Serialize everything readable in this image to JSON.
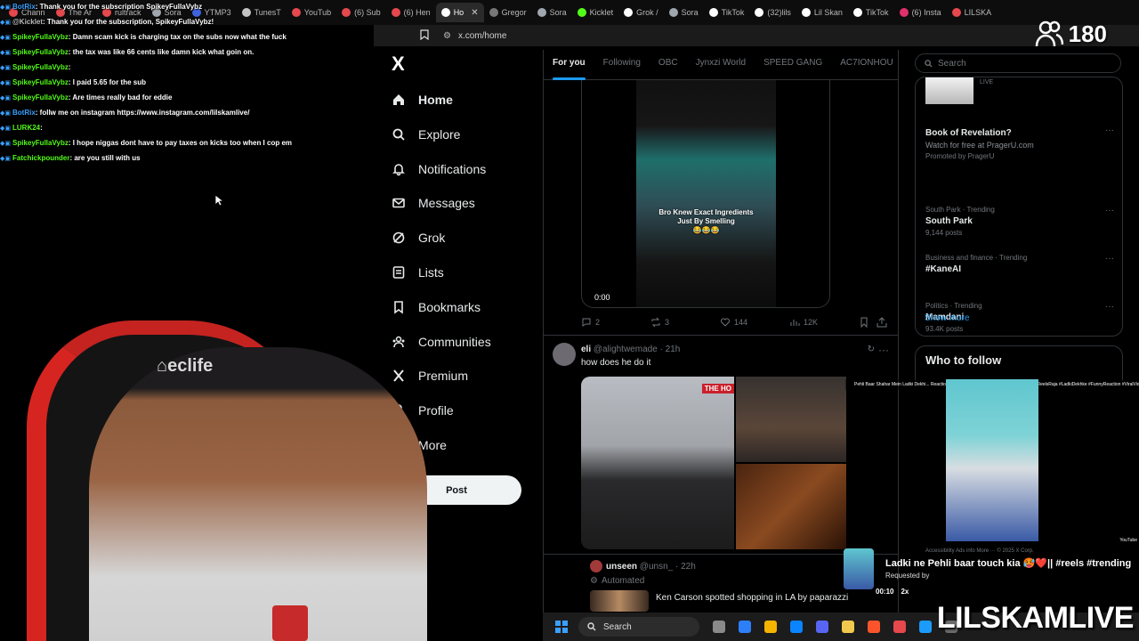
{
  "browser": {
    "tabs": [
      {
        "label": "Chann",
        "color": "#e5484d"
      },
      {
        "label": "The Ar",
        "color": "#e5484d"
      },
      {
        "label": "rultrack",
        "color": "#e5484d"
      },
      {
        "label": "Sora",
        "color": "#9fa6ad"
      },
      {
        "label": "YTMP3",
        "color": "#3e63dd"
      },
      {
        "label": "TunesT",
        "color": "#c4c4c4"
      },
      {
        "label": "YouTub",
        "color": "#e5484d"
      },
      {
        "label": "(6) Sub",
        "color": "#e5484d"
      },
      {
        "label": "(6) Hen",
        "color": "#e5484d"
      },
      {
        "label": "Ho",
        "color": "#ffffff",
        "active": true
      },
      {
        "label": "Gregor",
        "color": "#777777"
      },
      {
        "label": "Sora",
        "color": "#9fa6ad"
      },
      {
        "label": "Kicklet",
        "color": "#53fc18"
      },
      {
        "label": "Grok /",
        "color": "#ffffff"
      },
      {
        "label": "Sora",
        "color": "#9fa6ad"
      },
      {
        "label": "TikTok",
        "color": "#ffffff"
      },
      {
        "label": "(32)lils",
        "color": "#ffffff"
      },
      {
        "label": "Lil Skan",
        "color": "#ffffff"
      },
      {
        "label": "TikTok",
        "color": "#ffffff"
      },
      {
        "label": "(6) Insta",
        "color": "#e1306c"
      },
      {
        "label": "LILSKA",
        "color": "#e5484d"
      }
    ],
    "close_glyph": "✕",
    "url": "x.com/home"
  },
  "stream": {
    "viewer_count": "180",
    "brand": "LILSKAMLIVE",
    "chat": [
      {
        "user": "BotRix",
        "msg": ": Thank you for the subscription SpikeyFullaVybz",
        "color": "#3aa0ff"
      },
      {
        "user": "@Kicklet",
        "msg": ": Thank you for the subscription, SpikeyFullaVybz!",
        "color": "#bbbbbb"
      },
      {
        "user": "SpikeyFullaVybz",
        "msg": ": Damn scam kick is charging tax on the subs now what the fuck",
        "color": "#53fc18"
      },
      {
        "user": "SpikeyFullaVybz",
        "msg": ": the tax was like 66 cents like damn kick what goin on.",
        "color": "#53fc18"
      },
      {
        "user": "SpikeyFullaVybz",
        "msg": ":",
        "color": "#53fc18"
      },
      {
        "user": "SpikeyFullaVybz",
        "msg": ": I paid 5.65 for the sub",
        "color": "#53fc18"
      },
      {
        "user": "SpikeyFullaVybz",
        "msg": ": Are times really bad for eddie",
        "color": "#53fc18"
      },
      {
        "user": "BotRix",
        "msg": ": follw me on instagram https://www.instagram.com/lilskamlive/",
        "color": "#3aa0ff"
      },
      {
        "user": "LURK24",
        "msg": ":",
        "color": "#53fc18"
      },
      {
        "user": "SpikeyFullaVybz",
        "msg": ": I hope niggas dont have to pay taxes on kicks too when I cop em",
        "color": "#53fc18"
      },
      {
        "user": "Fatchickpounder",
        "msg": ": are you still with us",
        "color": "#53fc18"
      }
    ]
  },
  "nav": {
    "logo": "X",
    "items": [
      {
        "label": "Home",
        "icon": "home-icon"
      },
      {
        "label": "Explore",
        "icon": "search-icon"
      },
      {
        "label": "Notifications",
        "icon": "bell-icon"
      },
      {
        "label": "Messages",
        "icon": "mail-icon"
      },
      {
        "label": "Grok",
        "icon": "grok-icon"
      },
      {
        "label": "Lists",
        "icon": "list-icon"
      },
      {
        "label": "Bookmarks",
        "icon": "bookmark-icon"
      },
      {
        "label": "Communities",
        "icon": "people-icon"
      },
      {
        "label": "Premium",
        "icon": "x-icon"
      },
      {
        "label": "Profile",
        "icon": "person-icon"
      },
      {
        "label": "More",
        "icon": "more-circle-icon"
      }
    ],
    "post_label": "Post"
  },
  "feed": {
    "tabs": [
      "For you",
      "Following",
      "OBC",
      "Jynxzi World",
      "SPEED GANG",
      "AC7IONHOU"
    ],
    "active_tab": "For you",
    "tweet1": {
      "video_caption_1": "Bro Knew Exact Ingredients",
      "video_caption_2": "Just By Smelling",
      "video_emoji": "😂😂😂",
      "video_time": "0:00",
      "replies": "2",
      "reposts": "3",
      "likes": "144",
      "views": "12K"
    },
    "tweet2": {
      "name": "eli",
      "handle": "@alightwemade · 21h",
      "text": "how does he do it",
      "media_tag": "THE HO"
    },
    "tweet3": {
      "name": "unseen",
      "handle": "@unsn_ · 22h",
      "automated": "Automated",
      "text": "Ken Carson spotted shopping in LA by paparazzi"
    }
  },
  "sidebar": {
    "search_placeholder": "Search",
    "ad": {
      "live": "LIVE",
      "title": "Book of Revelation?",
      "sub": "Watch for free at PragerU.com",
      "promo": "Promoted by PragerU"
    },
    "trends": [
      {
        "context": "South Park · Trending",
        "title": "South Park",
        "count": "9,144 posts"
      },
      {
        "context": "Business and finance · Trending",
        "title": "#KaneAI",
        "count": ""
      },
      {
        "context": "Politics · Trending",
        "title": "Mamdani",
        "count": "93.4K posts"
      }
    ],
    "show_more": "Show more",
    "who_to_follow": "Who to follow",
    "footer": "Accessibility   Ads info   More ···   © 2025 X Corp."
  },
  "reel": {
    "title": "Pehli Baar Shahar Mein Ladki Dekhi... Reaction Dekh Ke Hans Padoge 😂 #shorts #Funny #ReelsRaja #LadkiDekhke #FunnyReaction #ViralVideo",
    "yt": "YouTube",
    "now_playing": "Ladki ne Pehli baar touch kia 🥵❤️|| #reels #trending",
    "requested_by": "Requested by",
    "time": "00:10",
    "speed": "2x"
  },
  "taskbar": {
    "search_label": "Search",
    "apps": [
      "#8a8a8a",
      "#2d7ff9",
      "#f5b400",
      "#0a84ff",
      "#5865f2",
      "#f2c94c",
      "#fb542b",
      "#e5484d",
      "#1b9cfc",
      "#6b6b6b"
    ]
  }
}
